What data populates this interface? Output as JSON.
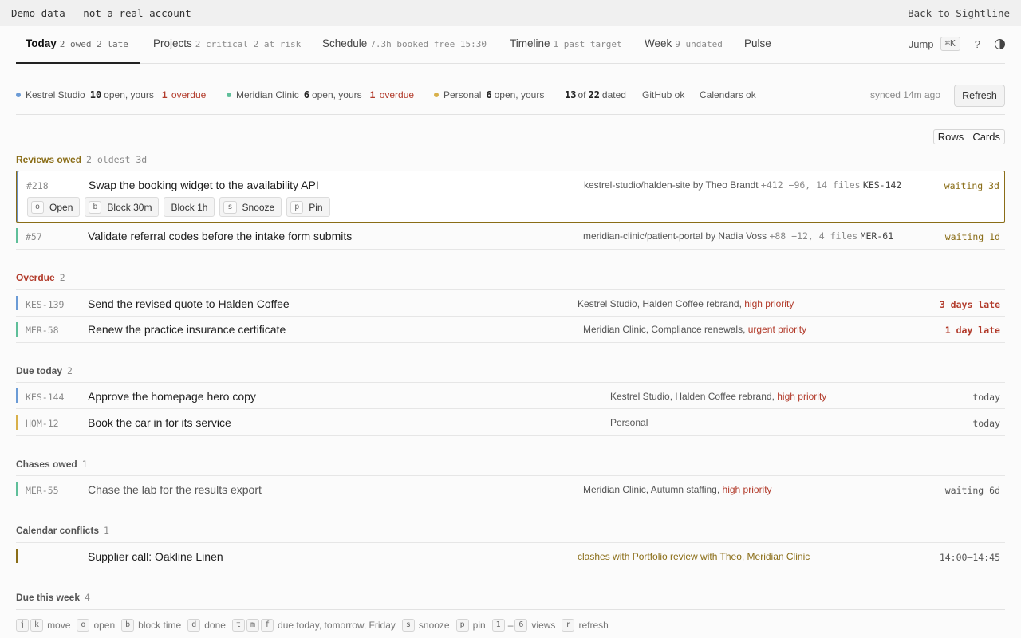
{
  "demo_bar": {
    "notice": "Demo data — not a real account",
    "back_link": "Back to Sightline"
  },
  "nav": {
    "tabs": [
      {
        "label": "Today",
        "sub": "2 owed  2 late"
      },
      {
        "label": "Projects",
        "sub": "2 critical  2 at risk"
      },
      {
        "label": "Schedule",
        "sub": "7.3h booked  free 15:30"
      },
      {
        "label": "Timeline",
        "sub": "1 past target"
      },
      {
        "label": "Week",
        "sub": "9 undated"
      },
      {
        "label": "Pulse",
        "sub": ""
      }
    ],
    "jump_label": "Jump",
    "jump_key": "⌘K",
    "help": "?"
  },
  "summary": {
    "kestrel": {
      "name": "Kestrel Studio",
      "open": "10",
      "open_label": "open, yours",
      "overdue": "1",
      "overdue_label": "overdue",
      "color": "#6b9bd6"
    },
    "meridian": {
      "name": "Meridian Clinic",
      "open": "6",
      "open_label": "open, yours",
      "overdue": "1",
      "overdue_label": "overdue",
      "color": "#5fbf9a"
    },
    "personal": {
      "name": "Personal",
      "open": "6",
      "open_label": "open, yours",
      "color": "#d8b04a"
    },
    "dated": {
      "n": "13",
      "of": "of",
      "total": "22",
      "label": "dated"
    },
    "github": "GitHub ok",
    "calendars": "Calendars ok",
    "synced": "synced 14m ago",
    "refresh": "Refresh"
  },
  "view_toggle": {
    "rows": "Rows",
    "cards": "Cards"
  },
  "sections": {
    "reviews": {
      "title": "Reviews owed",
      "count": "2  oldest 3d"
    },
    "overdue": {
      "title": "Overdue",
      "count": "2"
    },
    "due_today": {
      "title": "Due today",
      "count": "2"
    },
    "chases": {
      "title": "Chases owed",
      "count": "1"
    },
    "conflicts": {
      "title": "Calendar conflicts",
      "count": "1"
    },
    "due_week": {
      "title": "Due this week",
      "count": "4"
    }
  },
  "reviews": [
    {
      "id": "#218",
      "title": "Swap the booking widget to the availability API",
      "repo": "kestrel-studio/halden-site by Theo Brandt",
      "diff": "+412 −96, 14 files",
      "key": "KES-142",
      "status": "waiting 3d"
    },
    {
      "id": "#57",
      "title": "Validate referral codes before the intake form submits",
      "repo": "meridian-clinic/patient-portal by Nadia Voss",
      "diff": "+88 −12, 4 files",
      "key": "MER-61",
      "status": "waiting 1d"
    }
  ],
  "actions": [
    {
      "key": "o",
      "label": "Open"
    },
    {
      "key": "b",
      "label": "Block 30m"
    },
    {
      "key": "",
      "label": "Block 1h"
    },
    {
      "key": "s",
      "label": "Snooze"
    },
    {
      "key": "p",
      "label": "Pin"
    }
  ],
  "overdue": [
    {
      "id": "KES-139",
      "title": "Send the revised quote to Halden Coffee",
      "context": "Kestrel Studio, Halden Coffee rebrand, ",
      "priority": "high priority",
      "status": "3 days late"
    },
    {
      "id": "MER-58",
      "title": "Renew the practice insurance certificate",
      "context": "Meridian Clinic, Compliance renewals, ",
      "priority": "urgent priority",
      "status": "1 day late"
    }
  ],
  "due_today": [
    {
      "id": "KES-144",
      "title": "Approve the homepage hero copy",
      "context": "Kestrel Studio, Halden Coffee rebrand, ",
      "priority": "high priority",
      "status": "today"
    },
    {
      "id": "HOM-12",
      "title": "Book the car in for its service",
      "context": "Personal",
      "priority": "",
      "status": "today"
    }
  ],
  "chases": [
    {
      "id": "MER-55",
      "title": "Chase the lab for the results export",
      "context": "Meridian Clinic, Autumn staffing, ",
      "priority": "high priority",
      "status": "waiting 6d"
    }
  ],
  "conflicts": [
    {
      "title": "Supplier call: Oakline Linen",
      "context": "clashes with Portfolio review with Theo, Meridian Clinic",
      "time": "14:00–14:45"
    }
  ],
  "footer": {
    "j": "j",
    "k": "k",
    "move": "move",
    "o": "o",
    "open": "open",
    "b": "b",
    "block": "block time",
    "d": "d",
    "done": "done",
    "t": "t",
    "m": "m",
    "f": "f",
    "due": "due today, tomorrow, Friday",
    "s": "s",
    "snooze": "snooze",
    "p": "p",
    "pin": "pin",
    "one": "1",
    "dash": "–",
    "six": "6",
    "views": "views",
    "r": "r",
    "refresh": "refresh"
  },
  "colors": {
    "kestrel": "#6b9bd6",
    "meridian": "#5fbf9a",
    "personal": "#d8b04a",
    "amber": "#8a6d17",
    "red": "#b23b2b",
    "conflict": "#8a6d17"
  }
}
